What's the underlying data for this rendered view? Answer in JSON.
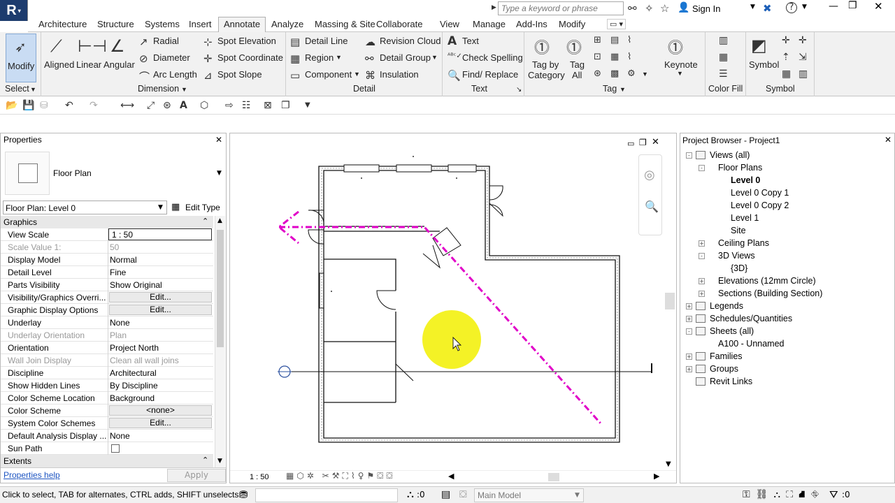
{
  "titlebar": {
    "app_logo": "R",
    "search_placeholder": "Type a keyword or phrase",
    "sign_in": "Sign In"
  },
  "tabs": [
    "Architecture",
    "Structure",
    "Systems",
    "Insert",
    "Annotate",
    "Analyze",
    "Massing & Site",
    "Collaborate",
    "View",
    "Manage",
    "Add-Ins",
    "Modify"
  ],
  "active_tab": "Annotate",
  "ribbon": {
    "modify": "Modify",
    "select_panel": "Select",
    "dimension": {
      "aligned": "Aligned",
      "linear": "Linear",
      "angular": "Angular",
      "radial": "Radial",
      "diameter": "Diameter",
      "arc_length": "Arc Length",
      "spot_elevation": "Spot Elevation",
      "spot_coordinate": "Spot Coordinate",
      "spot_slope": "Spot Slope",
      "panel": "Dimension"
    },
    "detail": {
      "detail_line": "Detail Line",
      "region": "Region",
      "component": "Component",
      "revision_cloud": "Revision Cloud",
      "detail_group": "Detail Group",
      "insulation": "Insulation",
      "panel": "Detail"
    },
    "text": {
      "text": "Text",
      "check_spelling": "Check Spelling",
      "find_replace": "Find/ Replace",
      "panel": "Text"
    },
    "tag": {
      "tag_by_category_1": "Tag by",
      "tag_by_category_2": "Category",
      "tag_all_1": "Tag",
      "tag_all_2": "All",
      "keynote": "Keynote",
      "panel": "Tag"
    },
    "color_fill": {
      "panel": "Color Fill"
    },
    "symbol": {
      "symbol": "Symbol",
      "panel": "Symbol"
    }
  },
  "properties": {
    "title": "Properties",
    "type_name": "Floor Plan",
    "instance_selector": "Floor Plan: Level 0",
    "edit_type": "Edit Type",
    "graphics_header": "Graphics",
    "rows": [
      {
        "key": "View Scale",
        "value": "1 : 50",
        "kind": "input"
      },
      {
        "key": "Scale Value    1:",
        "value": "50",
        "kind": "gray"
      },
      {
        "key": "Display Model",
        "value": "Normal"
      },
      {
        "key": "Detail Level",
        "value": "Fine"
      },
      {
        "key": "Parts Visibility",
        "value": "Show Original"
      },
      {
        "key": "Visibility/Graphics Overri...",
        "value": "Edit...",
        "kind": "button"
      },
      {
        "key": "Graphic Display Options",
        "value": "Edit...",
        "kind": "button"
      },
      {
        "key": "Underlay",
        "value": "None"
      },
      {
        "key": "Underlay Orientation",
        "value": "Plan",
        "kind": "gray"
      },
      {
        "key": "Orientation",
        "value": "Project North"
      },
      {
        "key": "Wall Join Display",
        "value": "Clean all wall joins",
        "kind": "gray"
      },
      {
        "key": "Discipline",
        "value": "Architectural"
      },
      {
        "key": "Show Hidden Lines",
        "value": "By Discipline"
      },
      {
        "key": "Color Scheme Location",
        "value": "Background"
      },
      {
        "key": "Color Scheme",
        "value": "<none>",
        "kind": "button"
      },
      {
        "key": "System Color Schemes",
        "value": "Edit...",
        "kind": "button"
      },
      {
        "key": "Default Analysis Display ...",
        "value": "None"
      },
      {
        "key": "Sun Path",
        "value": "",
        "kind": "checkbox"
      }
    ],
    "extents_header": "Extents",
    "help_link": "Properties help",
    "apply": "Apply"
  },
  "canvas": {
    "scale": "1 : 50"
  },
  "project_browser": {
    "title": "Project Browser - Project1",
    "nodes": [
      {
        "label": "Views (all)",
        "level": 0,
        "toggle": "-"
      },
      {
        "label": "Floor Plans",
        "level": 1,
        "toggle": "-"
      },
      {
        "label": "Level 0",
        "level": 2,
        "toggle": "",
        "bold": true
      },
      {
        "label": "Level 0 Copy 1",
        "level": 2,
        "toggle": ""
      },
      {
        "label": "Level 0 Copy 2",
        "level": 2,
        "toggle": ""
      },
      {
        "label": "Level 1",
        "level": 2,
        "toggle": ""
      },
      {
        "label": "Site",
        "level": 2,
        "toggle": ""
      },
      {
        "label": "Ceiling Plans",
        "level": 1,
        "toggle": "+"
      },
      {
        "label": "3D Views",
        "level": 1,
        "toggle": "-"
      },
      {
        "label": "{3D}",
        "level": 2,
        "toggle": ""
      },
      {
        "label": "Elevations (12mm Circle)",
        "level": 1,
        "toggle": "+"
      },
      {
        "label": "Sections (Building Section)",
        "level": 1,
        "toggle": "+"
      },
      {
        "label": "Legends",
        "level": 0,
        "toggle": "+"
      },
      {
        "label": "Schedules/Quantities",
        "level": 0,
        "toggle": "+"
      },
      {
        "label": "Sheets (all)",
        "level": 0,
        "toggle": "-"
      },
      {
        "label": "A100 - Unnamed",
        "level": 1,
        "toggle": ""
      },
      {
        "label": "Families",
        "level": 0,
        "toggle": "+"
      },
      {
        "label": "Groups",
        "level": 0,
        "toggle": "+"
      },
      {
        "label": "Revit Links",
        "level": 0,
        "toggle": ""
      }
    ]
  },
  "statusbar": {
    "message": "Click to select, TAB for alternates, CTRL adds, SHIFT unselects.",
    "worksets_count": ":0",
    "model": "Main Model",
    "filter_count": ":0"
  },
  "colors": {
    "accent": "#e100c8",
    "highlight": "#f2f000",
    "ribbon": "#f1f1f1"
  }
}
